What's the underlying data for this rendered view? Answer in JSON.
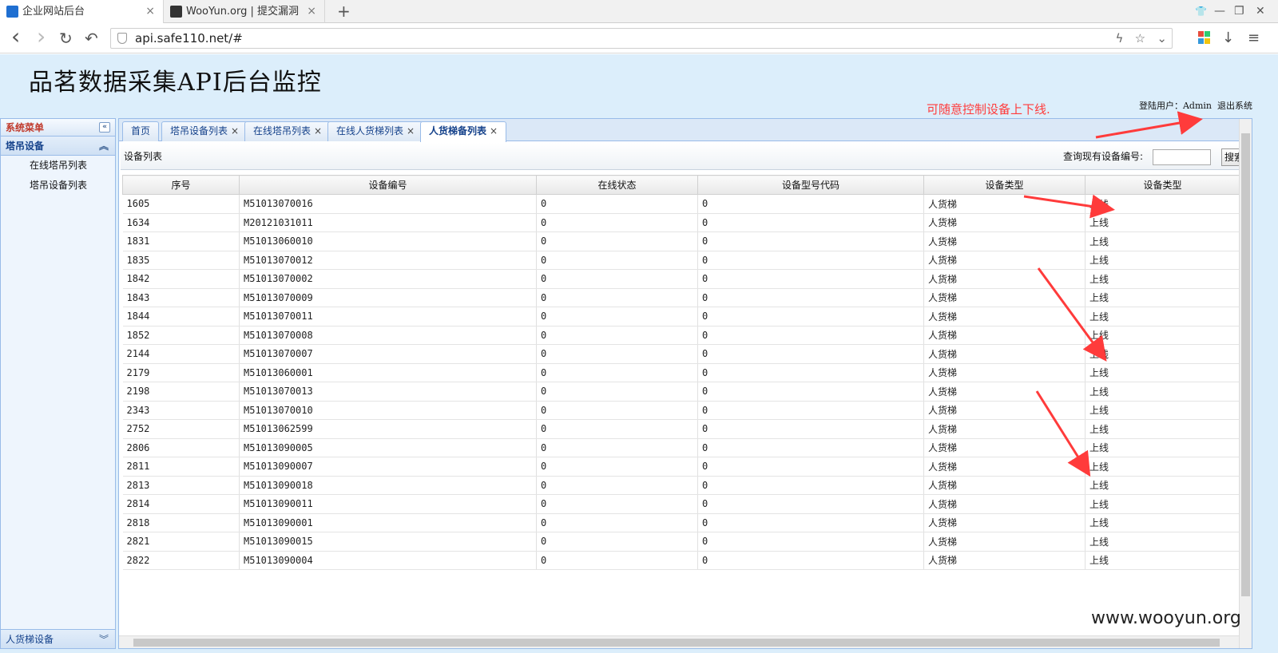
{
  "browser": {
    "tabs": [
      {
        "title": "企业网站后台",
        "close": "×"
      },
      {
        "title": "WooYun.org | 提交漏洞",
        "close": "×"
      }
    ],
    "new_tab": "+",
    "address": "api.safe110.net/#",
    "controls": {
      "shirt": "👕",
      "minimize": "—",
      "maximize": "❐",
      "close": "✕"
    },
    "nav": {
      "back": "‹",
      "forward": "›",
      "reload": "↻",
      "undo": "↶"
    }
  },
  "header": {
    "title": "品茗数据采集API后台监控",
    "user_label": "登陆用户：",
    "user_name": "Admin",
    "logout": "退出系统"
  },
  "annotation": {
    "text": "可随意控制设备上下线.",
    "color": "#ff3b3b"
  },
  "sidebar": {
    "title": "系统菜单",
    "collapse": "«",
    "group": {
      "label": "塔吊设备",
      "caret": "︽"
    },
    "items": [
      {
        "label": "在线塔吊列表"
      },
      {
        "label": "塔吊设备列表"
      }
    ],
    "footer": {
      "label": "人货梯设备",
      "caret": "︾"
    }
  },
  "tabs": [
    {
      "label": "首页",
      "closable": false
    },
    {
      "label": "塔吊设备列表",
      "closable": true
    },
    {
      "label": "在线塔吊列表",
      "closable": true
    },
    {
      "label": "在线人货梯列表",
      "closable": true
    },
    {
      "label": "人货梯备列表",
      "closable": true
    }
  ],
  "toolbar": {
    "title": "设备列表",
    "query_label": "查询现有设备编号:",
    "search_button": "搜索"
  },
  "table": {
    "columns": [
      "序号",
      "设备编号",
      "在线状态",
      "设备型号代码",
      "设备类型",
      "设备类型"
    ],
    "rows": [
      [
        "1605",
        "M51013070016",
        "0",
        "0",
        "人货梯",
        "上线"
      ],
      [
        "1634",
        "M20121031011",
        "0",
        "0",
        "人货梯",
        "上线"
      ],
      [
        "1831",
        "M51013060010",
        "0",
        "0",
        "人货梯",
        "上线"
      ],
      [
        "1835",
        "M51013070012",
        "0",
        "0",
        "人货梯",
        "上线"
      ],
      [
        "1842",
        "M51013070002",
        "0",
        "0",
        "人货梯",
        "上线"
      ],
      [
        "1843",
        "M51013070009",
        "0",
        "0",
        "人货梯",
        "上线"
      ],
      [
        "1844",
        "M51013070011",
        "0",
        "0",
        "人货梯",
        "上线"
      ],
      [
        "1852",
        "M51013070008",
        "0",
        "0",
        "人货梯",
        "上线"
      ],
      [
        "2144",
        "M51013070007",
        "0",
        "0",
        "人货梯",
        "上线"
      ],
      [
        "2179",
        "M51013060001",
        "0",
        "0",
        "人货梯",
        "上线"
      ],
      [
        "2198",
        "M51013070013",
        "0",
        "0",
        "人货梯",
        "上线"
      ],
      [
        "2343",
        "M51013070010",
        "0",
        "0",
        "人货梯",
        "上线"
      ],
      [
        "2752",
        "M51013062599",
        "0",
        "0",
        "人货梯",
        "上线"
      ],
      [
        "2806",
        "M51013090005",
        "0",
        "0",
        "人货梯",
        "上线"
      ],
      [
        "2811",
        "M51013090007",
        "0",
        "0",
        "人货梯",
        "上线"
      ],
      [
        "2813",
        "M51013090018",
        "0",
        "0",
        "人货梯",
        "上线"
      ],
      [
        "2814",
        "M51013090011",
        "0",
        "0",
        "人货梯",
        "上线"
      ],
      [
        "2818",
        "M51013090001",
        "0",
        "0",
        "人货梯",
        "上线"
      ],
      [
        "2821",
        "M51013090015",
        "0",
        "0",
        "人货梯",
        "上线"
      ],
      [
        "2822",
        "M51013090004",
        "0",
        "0",
        "人货梯",
        "上线"
      ]
    ]
  },
  "watermark": "www.wooyun.org",
  "colors": {
    "accent": "#15428b",
    "page_bg": "#dceefb",
    "border": "#99bbe8"
  }
}
